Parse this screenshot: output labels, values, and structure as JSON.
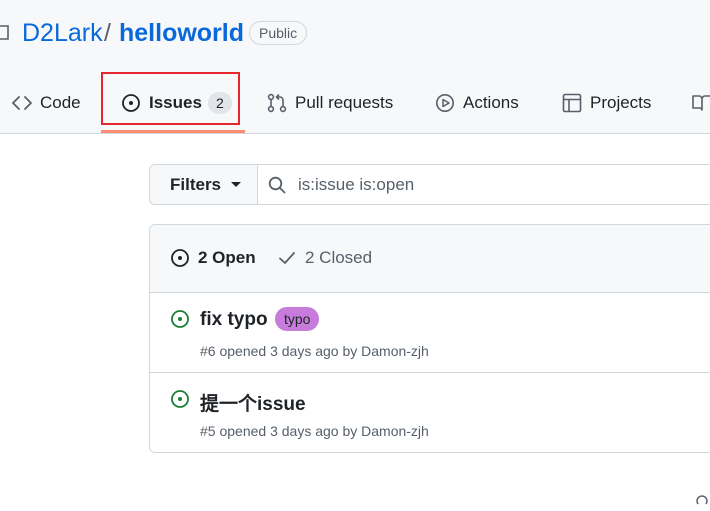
{
  "repo": {
    "owner": "D2Lark",
    "separator": "/",
    "name": "helloworld",
    "visibility": "Public"
  },
  "tabs": [
    {
      "label": "Code",
      "icon": "code-icon"
    },
    {
      "label": "Issues",
      "icon": "issue-opened-icon",
      "counter": "2",
      "selected": true
    },
    {
      "label": "Pull requests",
      "icon": "git-pull-request-icon"
    },
    {
      "label": "Actions",
      "icon": "play-icon"
    },
    {
      "label": "Projects",
      "icon": "table-icon"
    },
    {
      "label": "",
      "icon": "book-icon"
    }
  ],
  "filters": {
    "button_label": "Filters",
    "query": "is:issue is:open"
  },
  "issue_states": {
    "open_label": "2 Open",
    "closed_label": "2 Closed"
  },
  "issues": [
    {
      "title": "fix typo",
      "label": "typo",
      "meta": "#6 opened 3 days ago by Damon-zjh"
    },
    {
      "title": "提一个issue",
      "label": "",
      "meta": "#5 opened 3 days ago by Damon-zjh"
    }
  ],
  "colors": {
    "link": "#0969da",
    "open_green": "#1a7f37",
    "label_typo": "#c77cdb",
    "selected_underline": "#fd8c73",
    "highlight_box": "#e5272d"
  }
}
